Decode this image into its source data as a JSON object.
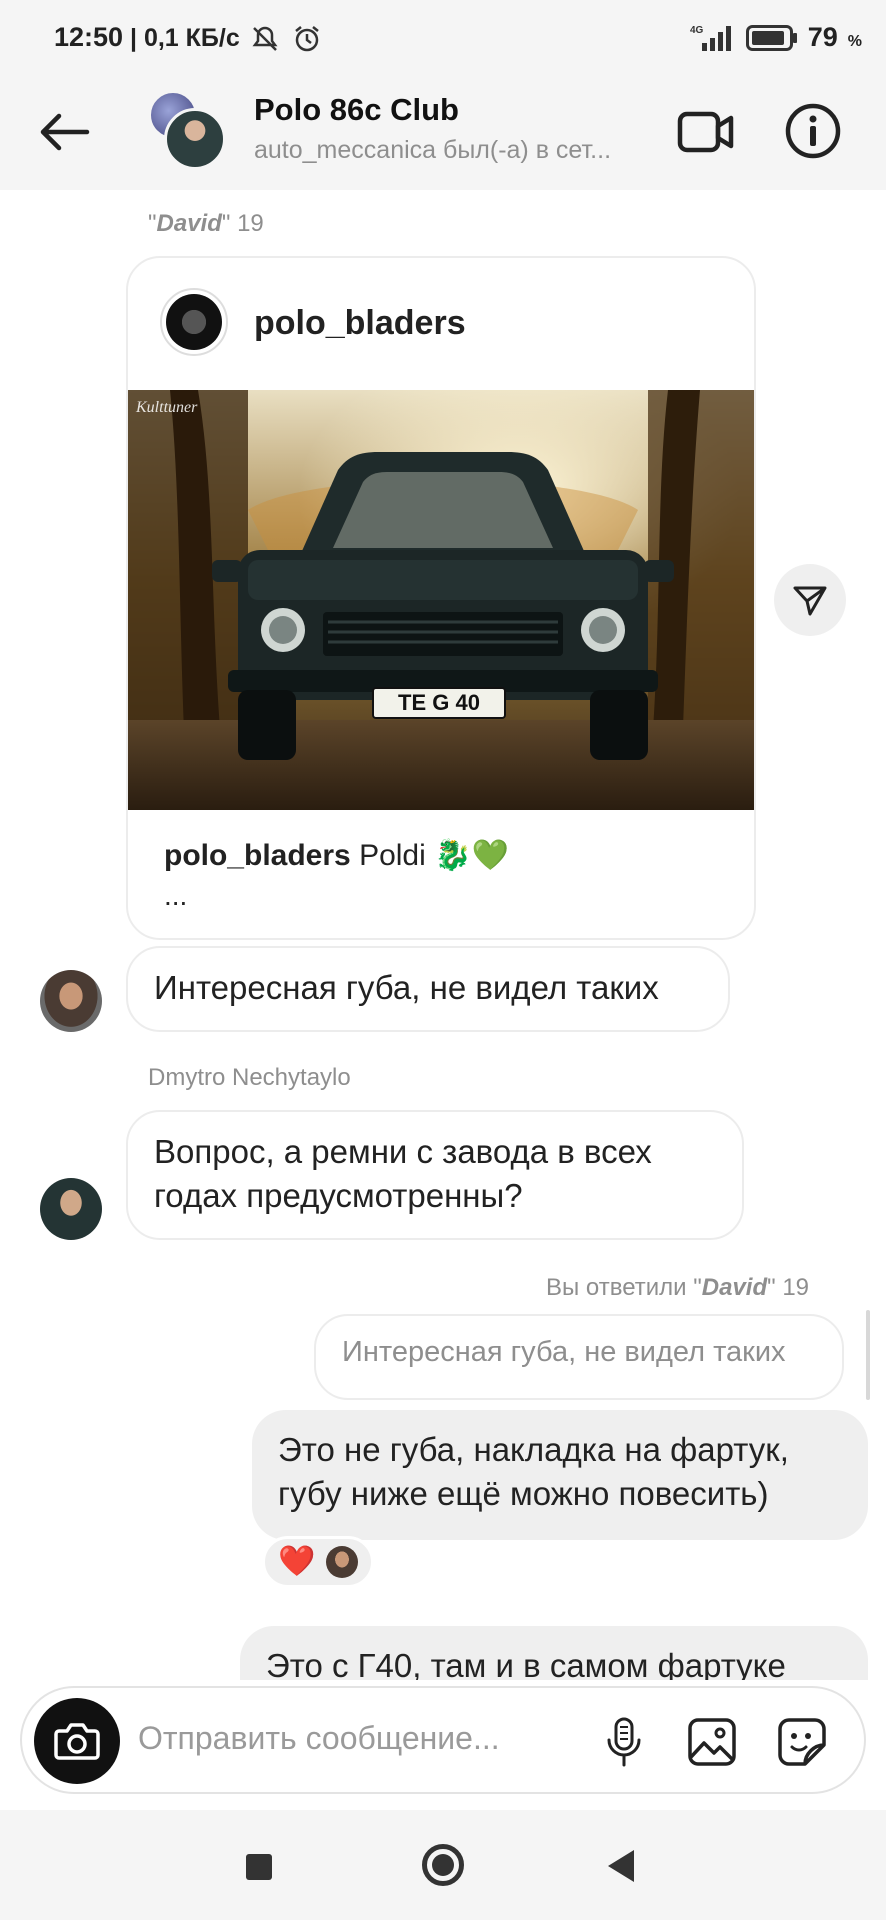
{
  "status_bar": {
    "time": "12:50",
    "speed": "| 0,1 КБ/с",
    "network": "4G",
    "battery": "79",
    "battery_unit": "%"
  },
  "header": {
    "title": "Polo 86c Club",
    "subtitle": "auto_meccanica был(-а) в сет..."
  },
  "messages": {
    "post_reply_meta_prefix": "\"",
    "post_reply_meta_name": "David",
    "post_reply_meta_suffix": "\" 19",
    "post": {
      "username": "polo_bladers",
      "caption_user": "polo_bladers",
      "caption_text": "Poldi 🐉💚",
      "more": "...",
      "plate": "TE G 40"
    },
    "msg1": "Интересная губа, не видел таких",
    "sender2": "Dmytro Nechytaylo",
    "msg2": "Вопрос,  а ремни с завода в всех годах предусмотренны?",
    "reply_meta_prefix": "Вы ответили \"",
    "reply_meta_name": "David",
    "reply_meta_suffix": "\" 19",
    "quoted": "Интересная губа, не видел таких",
    "msg3": "Это не губа, накладка на фартук, губу ниже ещё можно повесить)",
    "reaction": "❤️",
    "msg4": "Это с Г40, там и в самом фартуке"
  },
  "composer": {
    "placeholder": "Отправить сообщение..."
  },
  "colors": {
    "accent_heart": "#e0102a",
    "bubble_out": "#efefef",
    "meta_gray": "#8e8e8e"
  },
  "icons": [
    "back-arrow-icon",
    "video-call-icon",
    "info-icon",
    "share-icon",
    "camera-icon",
    "microphone-icon",
    "gallery-icon",
    "sticker-icon",
    "mute-icon",
    "alarm-icon",
    "signal-icon",
    "battery-icon"
  ]
}
